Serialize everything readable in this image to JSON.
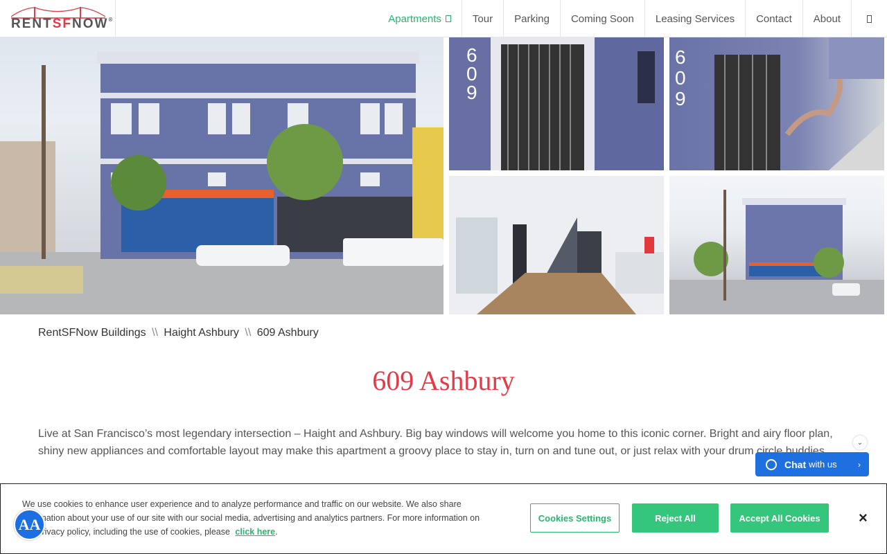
{
  "brand": {
    "logo_prefix": "RENT",
    "logo_sf": "SF",
    "logo_suffix": "NOW",
    "logo_reg": "®"
  },
  "nav": [
    {
      "label": "Apartments",
      "active": true
    },
    {
      "label": "Tour"
    },
    {
      "label": "Parking"
    },
    {
      "label": "Coming Soon"
    },
    {
      "label": "Leasing Services"
    },
    {
      "label": "Contact"
    },
    {
      "label": "About"
    }
  ],
  "breadcrumb": {
    "items": [
      "RentSFNow Buildings",
      "Haight Ashbury",
      "609 Ashbury"
    ],
    "separator": "\\\\"
  },
  "page": {
    "title": "609 Ashbury",
    "description": "Live at San Francisco’s most legendary intersection – Haight and Ashbury. Big bay windows will welcome you home to this iconic corner. Bright and airy floor plan, shiny new appliances and comfortable layout may make this apartment a groovy place to stay in, turn on and tune out, or just relax with your drum circle buddies."
  },
  "gallery": {
    "photo_numbers": [
      "6",
      "0",
      "9"
    ]
  },
  "chat": {
    "bold": "Chat",
    "rest": "with us"
  },
  "cookie": {
    "text": "We use cookies to enhance user experience and to analyze performance and traffic on our website. We also share information about your use of our site with our social media, advertising and analytics partners. For more information on our privacy policy, including the use of cookies, please",
    "link": "click here",
    "link_suffix": ".",
    "settings_label": "Cookies Settings",
    "reject_label": "Reject All",
    "accept_label": "Accept All Cookies",
    "close_label": "×"
  },
  "a11y_label": "AA",
  "colors": {
    "accent_green": "#2ab56d",
    "title_red": "#e53945",
    "chat_blue": "#1e6fe0"
  }
}
